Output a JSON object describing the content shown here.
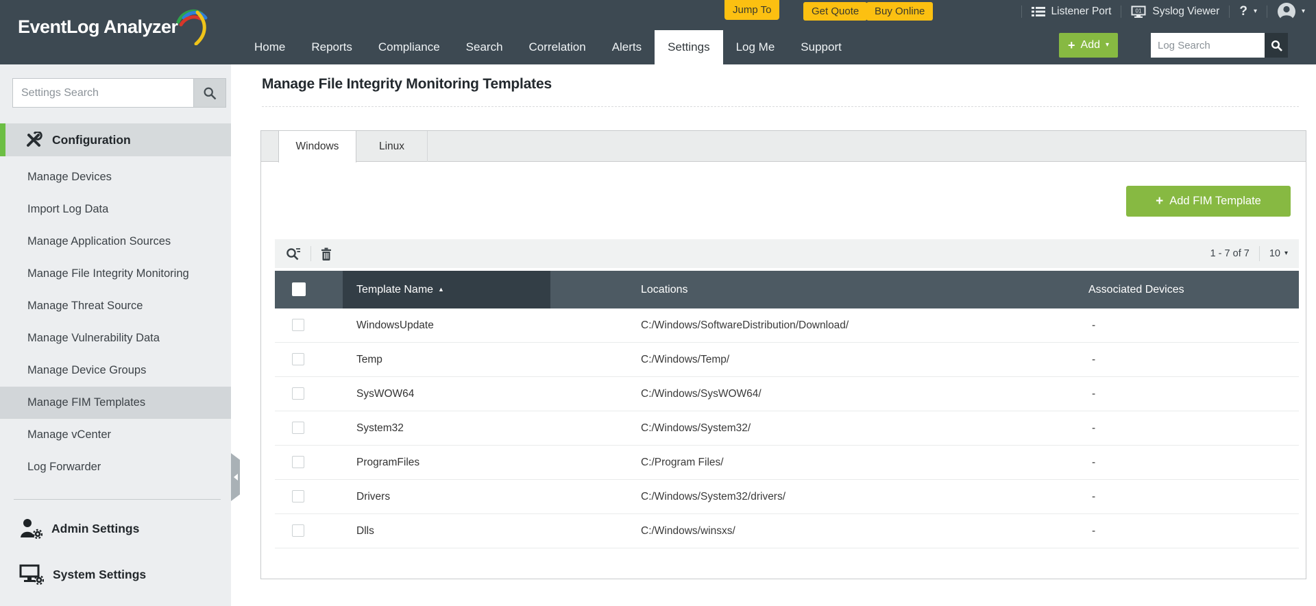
{
  "header": {
    "logo_text": "EventLog Analyzer",
    "promo_buttons": [
      {
        "label": "Jump To"
      },
      {
        "label": "Get Quote"
      },
      {
        "label": "Buy Online"
      }
    ],
    "utility": {
      "listener_port_label": "Listener Port",
      "syslog_viewer_label": "Syslog Viewer",
      "syslog_icon_text": "01",
      "help_label": "?"
    },
    "nav_items": [
      {
        "label": "Home",
        "active": false
      },
      {
        "label": "Reports",
        "active": false
      },
      {
        "label": "Compliance",
        "active": false
      },
      {
        "label": "Search",
        "active": false
      },
      {
        "label": "Correlation",
        "active": false
      },
      {
        "label": "Alerts",
        "active": false
      },
      {
        "label": "Settings",
        "active": true
      },
      {
        "label": "Log Me",
        "active": false
      },
      {
        "label": "Support",
        "active": false
      }
    ],
    "add_button_label": "Add",
    "log_search_placeholder": "Log Search"
  },
  "sidebar": {
    "search_placeholder": "Settings Search",
    "section_title": "Configuration",
    "items": [
      {
        "label": "Manage Devices",
        "selected": false
      },
      {
        "label": "Import Log Data",
        "selected": false
      },
      {
        "label": "Manage Application Sources",
        "selected": false
      },
      {
        "label": "Manage File Integrity Monitoring",
        "selected": false
      },
      {
        "label": "Manage Threat Source",
        "selected": false
      },
      {
        "label": "Manage Vulnerability Data",
        "selected": false
      },
      {
        "label": "Manage Device Groups",
        "selected": false
      },
      {
        "label": "Manage FIM Templates",
        "selected": true
      },
      {
        "label": "Manage vCenter",
        "selected": false
      },
      {
        "label": "Log Forwarder",
        "selected": false
      }
    ],
    "footer_items": [
      {
        "label": "Admin Settings"
      },
      {
        "label": "System Settings"
      }
    ]
  },
  "main": {
    "page_title": "Manage File Integrity Monitoring Templates",
    "tabs": [
      {
        "label": "Windows",
        "active": true
      },
      {
        "label": "Linux",
        "active": false
      }
    ],
    "add_template_button_label": "Add FIM Template",
    "pagination": {
      "range_text": "1 - 7 of 7",
      "page_size": "10"
    },
    "table": {
      "headers": {
        "name": "Template Name",
        "locations": "Locations",
        "devices": "Associated Devices"
      },
      "sorted_by": "Template Name",
      "sort_direction": "asc",
      "rows": [
        {
          "name": "WindowsUpdate",
          "location": "C:/Windows/SoftwareDistribution/Download/",
          "devices": "-"
        },
        {
          "name": "Temp",
          "location": "C:/Windows/Temp/",
          "devices": "-"
        },
        {
          "name": "SysWOW64",
          "location": "C:/Windows/SysWOW64/",
          "devices": "-"
        },
        {
          "name": "System32",
          "location": "C:/Windows/System32/",
          "devices": "-"
        },
        {
          "name": "ProgramFiles",
          "location": "C:/Program Files/",
          "devices": "-"
        },
        {
          "name": "Drivers",
          "location": "C:/Windows/System32/drivers/",
          "devices": "-"
        },
        {
          "name": "Dlls",
          "location": "C:/Windows/winsxs/",
          "devices": "-"
        }
      ]
    }
  },
  "icons": {
    "caret_down": "▾",
    "sort_asc": "▲",
    "plus": "+"
  },
  "colors": {
    "header_bg": "#3d4952",
    "accent_green": "#87b942",
    "accent_yellow": "#fcc011",
    "table_header_bg": "#4d5a63",
    "table_header_sorted_bg": "#333e46",
    "sidebar_bg": "#eceef0",
    "selected_item_bg": "#d2d6d9"
  }
}
